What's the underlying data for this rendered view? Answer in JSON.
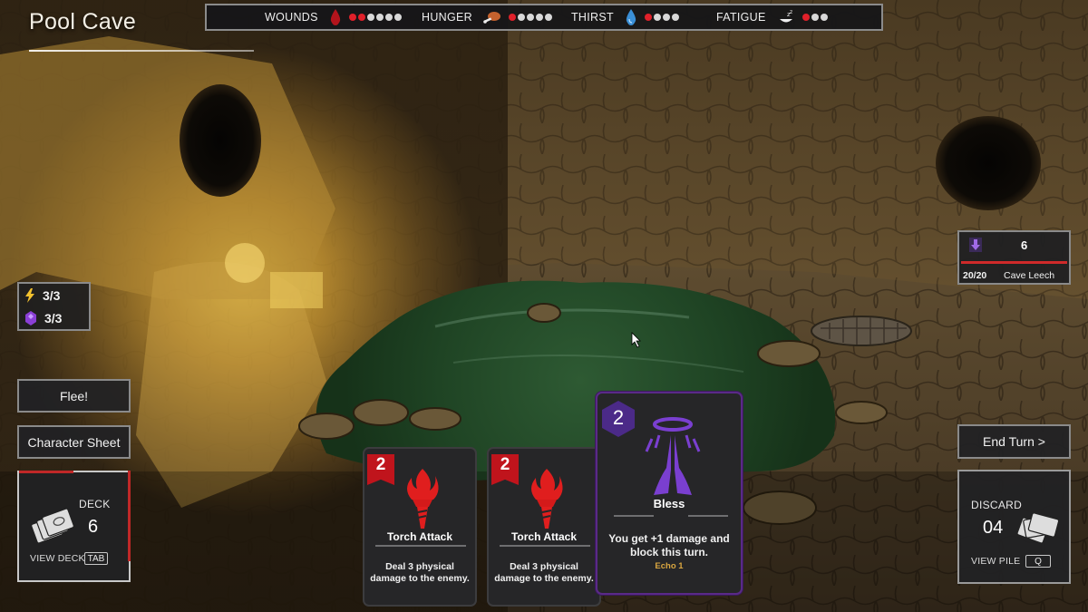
{
  "location": {
    "title": "Pool Cave"
  },
  "status": {
    "wounds": {
      "label": "WOUNDS",
      "filled": 2,
      "total": 6,
      "icon": "blood-drop-icon"
    },
    "hunger": {
      "label": "HUNGER",
      "filled": 1,
      "total": 5,
      "icon": "meat-icon"
    },
    "thirst": {
      "label": "THIRST",
      "filled": 1,
      "total": 4,
      "icon": "water-drop-icon"
    },
    "fatigue": {
      "label": "FATIGUE",
      "filled": 1,
      "total": 3,
      "icon": "sleep-icon"
    }
  },
  "resources": {
    "energy": {
      "value": "3/3",
      "icon": "lightning-icon"
    },
    "mana": {
      "value": "3/3",
      "icon": "purple-gem-icon"
    }
  },
  "buttons": {
    "flee": "Flee!",
    "character_sheet": "Character Sheet",
    "end_turn": "End Turn >"
  },
  "deck": {
    "label": "DECK",
    "count": "6",
    "action": "VIEW DECK",
    "key": "TAB"
  },
  "discard": {
    "label": "DISCARD",
    "count": "04",
    "action": "VIEW PILE",
    "key": "Q"
  },
  "enemy": {
    "intent_value": "6",
    "intent_icon": "down-arrow-icon",
    "hp": "20/20",
    "hp_fraction": 1.0,
    "name": "Cave Leech"
  },
  "hand": [
    {
      "cost": "2",
      "name": "Torch Attack",
      "description": "Deal 3 physical damage to the enemy.",
      "icon": "torch-icon"
    },
    {
      "cost": "2",
      "name": "Torch Attack",
      "description": "Deal 3 physical damage to the enemy.",
      "icon": "torch-icon"
    },
    {
      "cost": "2",
      "name": "Bless",
      "description": "You get +1 damage and block this turn.",
      "keyword": "Echo 1",
      "icon": "praying-hands-icon"
    }
  ],
  "colors": {
    "accent_red": "#e0202a",
    "card_purple": "#4b2a88",
    "echo_gold": "#d9a640",
    "pool_green": "#2f5a34"
  }
}
